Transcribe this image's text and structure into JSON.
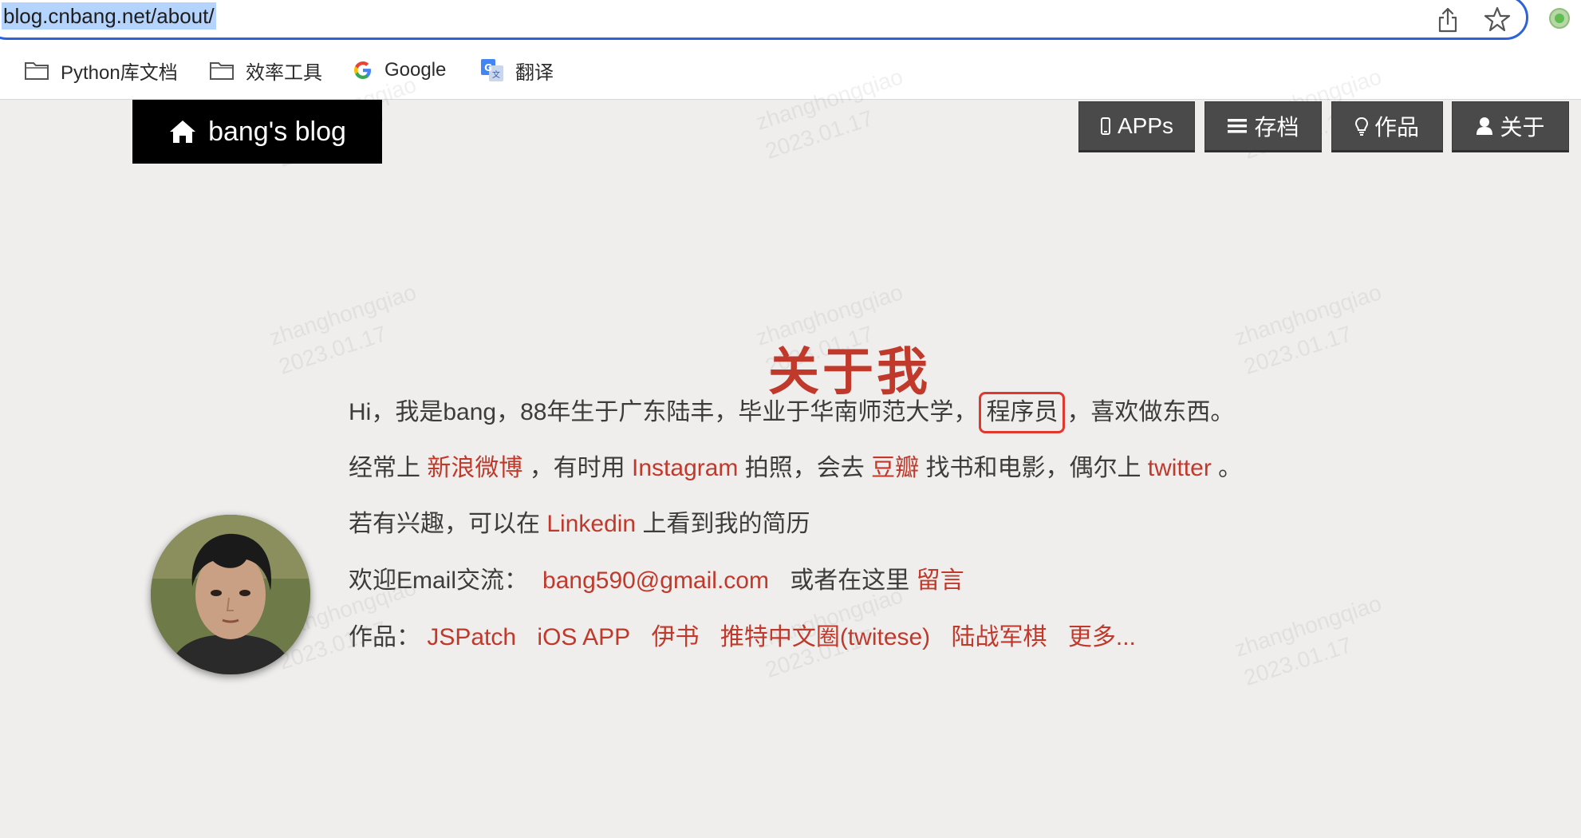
{
  "browser": {
    "url": "blog.cnbang.net/about/",
    "bookmarks": [
      {
        "label": "Python库文档",
        "icon": "folder-icon"
      },
      {
        "label": "效率工具",
        "icon": "folder-icon"
      },
      {
        "label": "Google",
        "icon": "google-icon"
      },
      {
        "label": "翻译",
        "icon": "translate-icon"
      }
    ]
  },
  "site": {
    "brand": "bang's blog",
    "nav": [
      {
        "label": "APPs",
        "icon": "mobile-icon"
      },
      {
        "label": "存档",
        "icon": "list-icon"
      },
      {
        "label": "作品",
        "icon": "lightbulb-icon"
      },
      {
        "label": "关于",
        "icon": "user-icon"
      }
    ]
  },
  "about": {
    "title": "关于我",
    "intro": {
      "before": "Hi，我是bang，88年生于广东陆丰，毕业于华南师范大学，",
      "highlight": "程序员",
      "after": "，喜欢做东西。"
    },
    "social": {
      "t1": "经常上",
      "weibo": "新浪微博",
      "t2": "，有时用",
      "instagram": "Instagram",
      "t3": "拍照，会去",
      "douban": "豆瓣",
      "t4": "找书和电影，偶尔上",
      "twitter": "twitter",
      "t5": "。"
    },
    "linkedin": {
      "before": "若有兴趣，可以在",
      "link": "Linkedin",
      "after": "上看到我的简历"
    },
    "email": {
      "before": "欢迎Email交流：",
      "address": "bang590@gmail.com",
      "middle": "或者在这里",
      "link": "留言"
    },
    "works": {
      "label": "作品：",
      "items": [
        "JSPatch",
        "iOS APP",
        "伊书",
        "推特中文圈(twitese)",
        "陆战军棋",
        "更多..."
      ]
    }
  },
  "watermark": {
    "line1": "zhanghongqiao",
    "line2": "2023.01.17"
  },
  "colors": {
    "accent": "#c0392b",
    "nav_bg": "#4a4a4a",
    "brand_bg": "#000000",
    "highlight_box": "#e0382c",
    "url_focus": "#2e62d9"
  }
}
